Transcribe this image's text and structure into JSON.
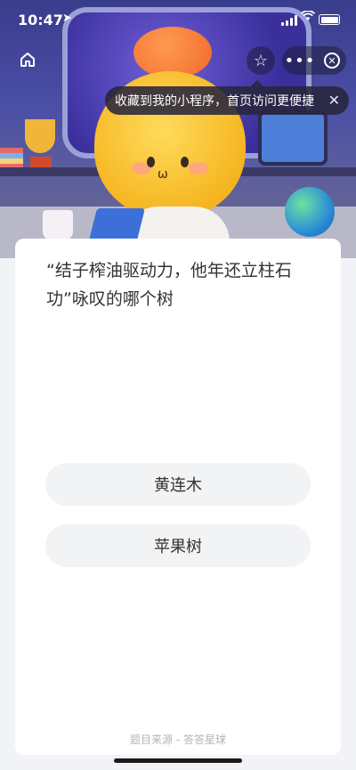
{
  "status_bar": {
    "time": "10:47"
  },
  "nav": {
    "tip_text": "收藏到我的小程序，首页访问更便捷"
  },
  "question": {
    "text": "“结子榨油驱动力，他年还立柱石功”咏叹的哪个树",
    "options": [
      {
        "label": "黄连木"
      },
      {
        "label": "苹果树"
      }
    ]
  },
  "footer": {
    "source": "题目来源 - 答答星球"
  },
  "colors": {
    "card_bg": "#ffffff",
    "option_bg": "#f2f3f5",
    "page_bg": "#f2f3f7"
  },
  "icons": [
    "location-arrow-icon",
    "signal-icon",
    "wifi-icon",
    "battery-icon",
    "home-icon",
    "star-icon",
    "more-icon",
    "close-circle-icon",
    "close-icon"
  ]
}
